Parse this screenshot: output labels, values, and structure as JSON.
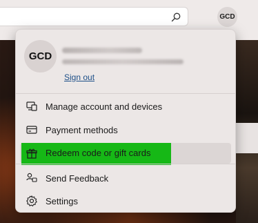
{
  "header": {
    "account_initials": "GCD"
  },
  "flyout": {
    "avatar_initials": "GCD",
    "sign_out_label": "Sign out",
    "items": [
      {
        "label": "Manage account and devices",
        "icon": "devices-icon"
      },
      {
        "label": "Payment methods",
        "icon": "credit-card-icon"
      },
      {
        "label": "Redeem code or gift cards",
        "icon": "gift-icon",
        "highlighted": true
      },
      {
        "label": "Send Feedback",
        "icon": "feedback-icon"
      },
      {
        "label": "Settings",
        "icon": "gear-icon"
      }
    ]
  },
  "colors": {
    "highlight": "#16b816",
    "link": "#1c4e87"
  }
}
